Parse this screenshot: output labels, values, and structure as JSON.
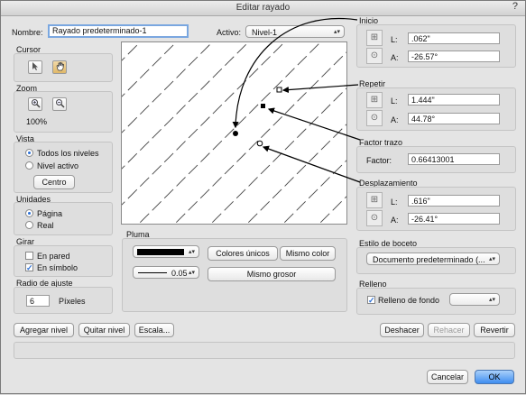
{
  "window": {
    "title": "Editar rayado",
    "help": "?"
  },
  "header": {
    "name_label": "Nombre:",
    "name_value": "Rayado predeterminado-1",
    "active_label": "Activo:",
    "active_value": "Nivel-1"
  },
  "cursor": {
    "title": "Cursor"
  },
  "zoom": {
    "title": "Zoom",
    "value": "100%"
  },
  "vista": {
    "title": "Vista",
    "opt_all": "Todos los niveles",
    "opt_active": "Nivel activo",
    "center_btn": "Centro"
  },
  "unidades": {
    "title": "Unidades",
    "opt_page": "Página",
    "opt_real": "Real"
  },
  "girar": {
    "title": "Girar",
    "opt_wall": "En pared",
    "opt_symbol": "En símbolo"
  },
  "radio_ajuste": {
    "title": "Radio de ajuste",
    "value": "6",
    "unit": "Píxeles"
  },
  "pluma": {
    "title": "Pluma",
    "weight": "0.05",
    "colores_unicos": "Colores únicos",
    "mismo_color": "Mismo color",
    "mismo_grosor": "Mismo grosor"
  },
  "inicio": {
    "title": "Inicio",
    "l_label": "L:",
    "l_value": ".062\"",
    "a_label": "A:",
    "a_value": "-26.57°"
  },
  "repetir": {
    "title": "Repetir",
    "l_label": "L:",
    "l_value": "1.444\"",
    "a_label": "A:",
    "a_value": "44.78°"
  },
  "factor": {
    "title": "Factor trazo",
    "label": "Factor:",
    "value": "0.66413001"
  },
  "desplaz": {
    "title": "Desplazamiento",
    "l_label": "L:",
    "l_value": ".616\"",
    "a_label": "A:",
    "a_value": "-26.41°"
  },
  "estilo": {
    "title": "Estilo de boceto",
    "value": "Documento predeterminado (..."
  },
  "relleno": {
    "title": "Relleno",
    "check_label": "Relleno de fondo"
  },
  "actions": {
    "add_level": "Agregar nivel",
    "remove_level": "Quitar nivel",
    "scale": "Escala...",
    "undo": "Deshacer",
    "redo": "Rehacer",
    "revert": "Revertir",
    "cancel": "Cancelar",
    "ok": "OK"
  },
  "icons": [
    "arrow-cursor-icon",
    "hand-icon",
    "zoom-in-icon",
    "zoom-out-icon",
    "grid-icon",
    "target-icon"
  ],
  "colors": {
    "accent": "#3f8ef0",
    "pen": "#000000"
  }
}
